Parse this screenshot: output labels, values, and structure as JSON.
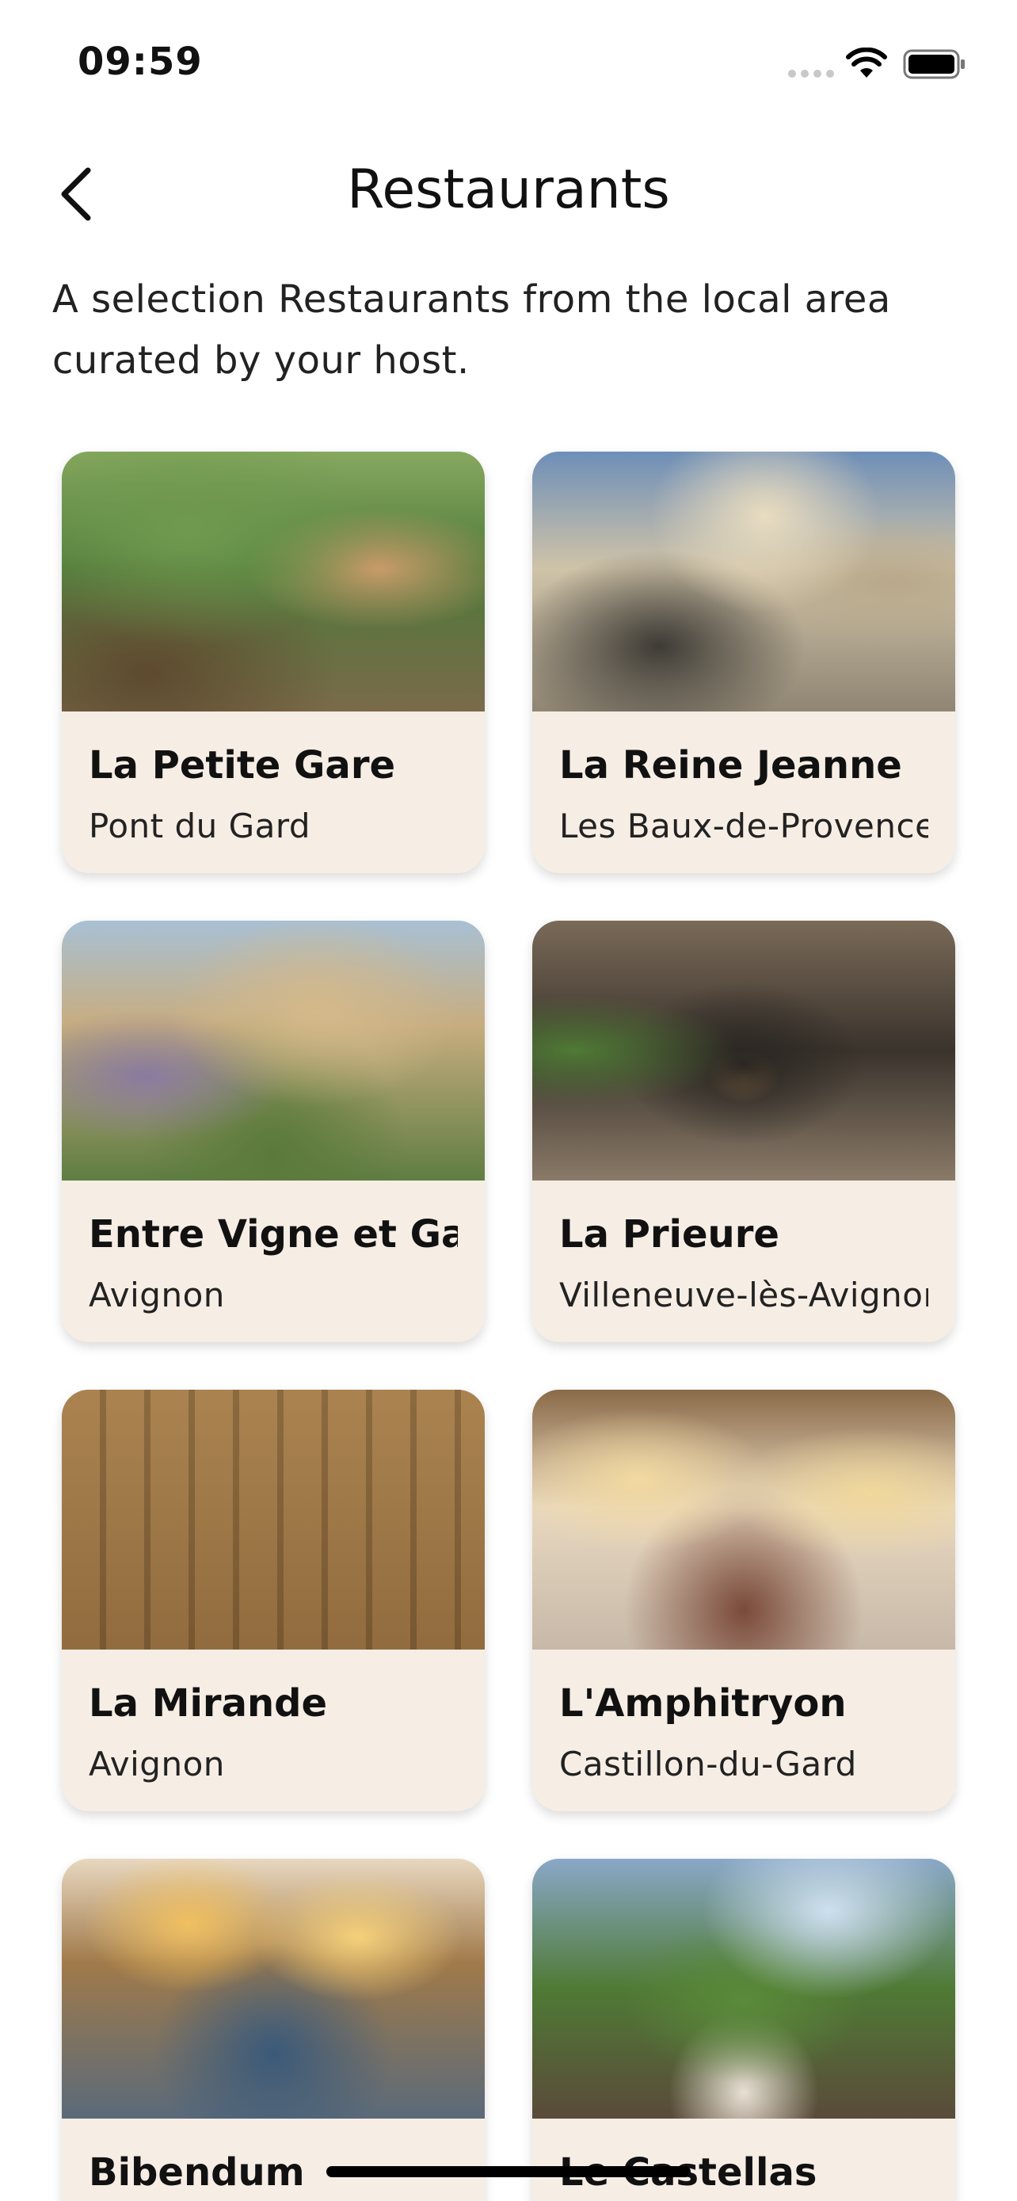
{
  "status_bar": {
    "time": "09:59"
  },
  "header": {
    "title": "Restaurants"
  },
  "subtitle": "A selection Restaurants from the local area curated by your host.",
  "restaurants": [
    {
      "name": "La Petite Gare",
      "location": "Pont du Gard"
    },
    {
      "name": "La Reine Jeanne",
      "location": "Les Baux-de-Provence"
    },
    {
      "name": "Entre Vigne et Garrigue",
      "location": "Avignon"
    },
    {
      "name": "La Prieure",
      "location": "Villeneuve-lès-Avignon"
    },
    {
      "name": "La Mirande",
      "location": "Avignon"
    },
    {
      "name": "L'Amphitryon",
      "location": "Castillon-du-Gard"
    },
    {
      "name": "Bibendum",
      "location": ""
    },
    {
      "name": "Le Castellas",
      "location": ""
    }
  ],
  "icons": {
    "back": "chevron-left-icon",
    "signal": "cellular-signal-icon",
    "wifi": "wifi-icon",
    "battery": "battery-icon"
  },
  "colors": {
    "card_background": "#f6ede4",
    "text": "#111111"
  }
}
